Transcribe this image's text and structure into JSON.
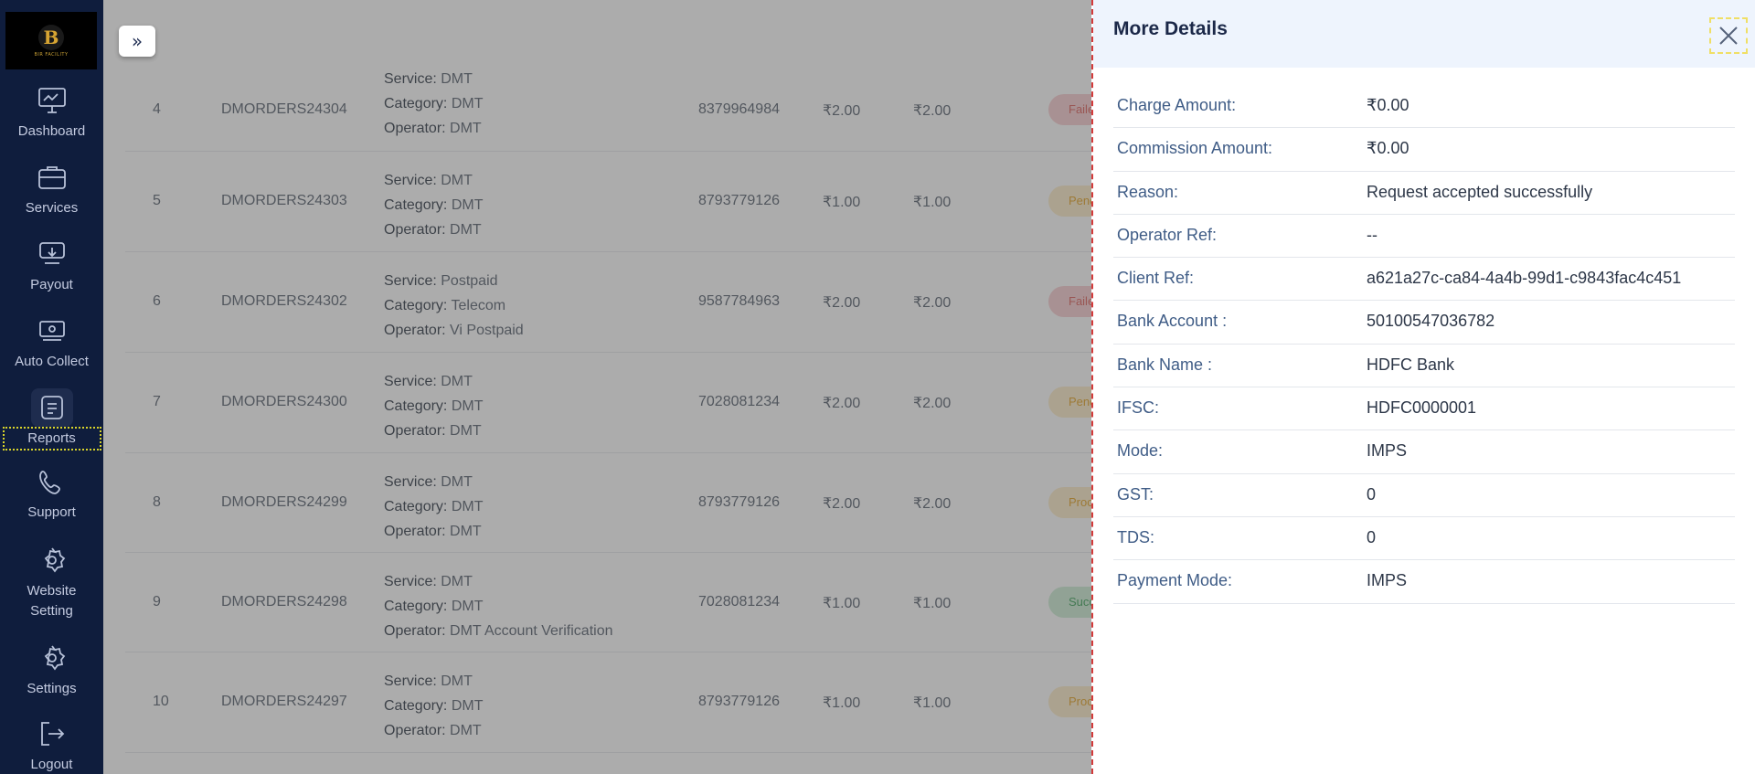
{
  "logo": {
    "letter": "B",
    "tagline": "BIR FACILITY"
  },
  "sidebar": {
    "items": [
      {
        "label": "Dashboard",
        "icon": "monitor-icon"
      },
      {
        "label": "Services",
        "icon": "briefcase-icon"
      },
      {
        "label": "Payout",
        "icon": "payout-icon"
      },
      {
        "label": "Auto Collect",
        "icon": "wallet-icon"
      },
      {
        "label": "Reports",
        "icon": "reports-icon"
      },
      {
        "label": "Support",
        "icon": "phone-icon"
      },
      {
        "label": "Website\nSetting",
        "icon": "gear-icon"
      },
      {
        "label": "Settings",
        "icon": "gear-icon"
      },
      {
        "label": "Logout",
        "icon": "logout-icon"
      }
    ]
  },
  "toggle": {
    "label": "»"
  },
  "table": {
    "labels": {
      "service": "Service:",
      "category": "Category:",
      "operator": "Operator:"
    },
    "rows": [
      {
        "num": "4",
        "order": "DMORDERS24304",
        "service": "DMT",
        "category": "DMT",
        "operator": "DMT",
        "mobile": "8379964984",
        "amount": "₹2.00",
        "amount2": "₹2.00",
        "status": "Failed",
        "status_class": "st-failed"
      },
      {
        "num": "5",
        "order": "DMORDERS24303",
        "service": "DMT",
        "category": "DMT",
        "operator": "DMT",
        "mobile": "8793779126",
        "amount": "₹1.00",
        "amount2": "₹1.00",
        "status": "Pending",
        "status_class": "st-pending"
      },
      {
        "num": "6",
        "order": "DMORDERS24302",
        "service": "Postpaid",
        "category": "Telecom",
        "operator": "Vi Postpaid",
        "mobile": "9587784963",
        "amount": "₹2.00",
        "amount2": "₹2.00",
        "status": "Failed",
        "status_class": "st-failed"
      },
      {
        "num": "7",
        "order": "DMORDERS24300",
        "service": "DMT",
        "category": "DMT",
        "operator": "DMT",
        "mobile": "7028081234",
        "amount": "₹2.00",
        "amount2": "₹2.00",
        "status": "Pending",
        "status_class": "st-pending"
      },
      {
        "num": "8",
        "order": "DMORDERS24299",
        "service": "DMT",
        "category": "DMT",
        "operator": "DMT",
        "mobile": "8793779126",
        "amount": "₹2.00",
        "amount2": "₹2.00",
        "status": "Process",
        "status_class": "st-process"
      },
      {
        "num": "9",
        "order": "DMORDERS24298",
        "service": "DMT",
        "category": "DMT",
        "operator": "DMT Account Verification",
        "mobile": "7028081234",
        "amount": "₹1.00",
        "amount2": "₹1.00",
        "status": "Success",
        "status_class": "st-success"
      },
      {
        "num": "10",
        "order": "DMORDERS24297",
        "service": "DMT",
        "category": "DMT",
        "operator": "DMT",
        "mobile": "8793779126",
        "amount": "₹1.00",
        "amount2": "₹1.00",
        "status": "Process",
        "status_class": "st-process"
      }
    ]
  },
  "drawer": {
    "title": "More Details",
    "close_icon": "close-icon",
    "details": [
      {
        "key": "Charge Amount:",
        "value": "₹0.00"
      },
      {
        "key": "Commission Amount:",
        "value": "₹0.00"
      },
      {
        "key": "Reason:",
        "value": "Request accepted successfully"
      },
      {
        "key": "Operator Ref:",
        "value": "--"
      },
      {
        "key": "Client Ref:",
        "value": "a621a27c-ca84-4a4b-99d1-c9843fac4c451"
      },
      {
        "key": "Bank Account :",
        "value": "50100547036782"
      },
      {
        "key": "Bank Name :",
        "value": "HDFC Bank"
      },
      {
        "key": "IFSC:",
        "value": "HDFC0000001"
      },
      {
        "key": "Mode:",
        "value": "IMPS"
      },
      {
        "key": "GST:",
        "value": "0"
      },
      {
        "key": "TDS:",
        "value": "0"
      },
      {
        "key": "Payment Mode:",
        "value": "IMPS"
      }
    ]
  },
  "colors": {
    "sidebar": "#0f1d3d",
    "drawer_header": "#eef4fd",
    "accent": "#1b2848"
  }
}
